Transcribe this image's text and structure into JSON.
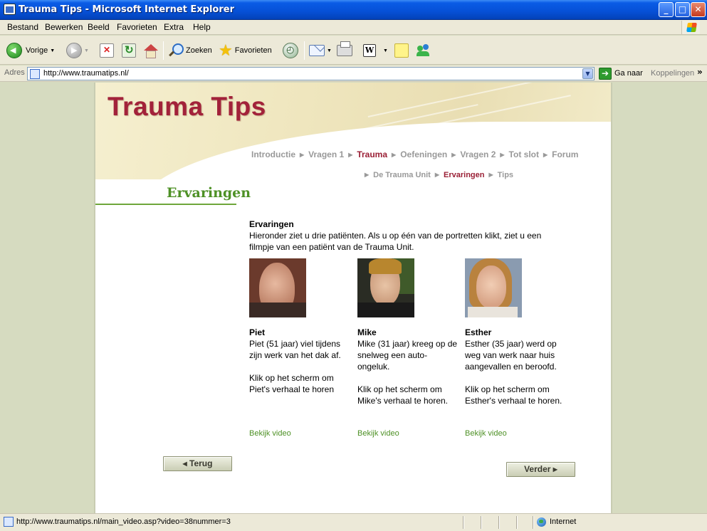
{
  "window": {
    "title": "Trauma Tips - Microsoft Internet Explorer",
    "minimize": "_",
    "maximize": "□",
    "close": "✕"
  },
  "menu": {
    "items": [
      "Bestand",
      "Bewerken",
      "Beeld",
      "Favorieten",
      "Extra",
      "Help"
    ]
  },
  "toolbar": {
    "back_label": "Vorige",
    "search_label": "Zoeken",
    "favorites_label": "Favorieten",
    "icons": [
      "back-icon",
      "forward-icon",
      "stop-icon",
      "refresh-icon",
      "home-icon",
      "search-icon",
      "favorites-star-icon",
      "media-icon",
      "mail-icon",
      "print-icon",
      "word-icon",
      "note-icon",
      "messenger-icon"
    ],
    "word_glyph": "W"
  },
  "address": {
    "label": "Adres",
    "url": "http://www.traumatips.nl/",
    "go_label": "Ga naar",
    "links_label": "Koppelingen",
    "overflow": "»"
  },
  "site": {
    "logo": "Trauma Tips",
    "nav_primary": [
      {
        "label": "Introductie",
        "active": false
      },
      {
        "label": "Vragen 1",
        "active": false
      },
      {
        "label": "Trauma",
        "active": true
      },
      {
        "label": "Oefeningen",
        "active": false
      },
      {
        "label": "Vragen 2",
        "active": false
      },
      {
        "label": "Tot slot",
        "active": false
      },
      {
        "label": "Forum",
        "active": false
      }
    ],
    "nav_secondary": [
      {
        "label": "De Trauma Unit",
        "active": false
      },
      {
        "label": "Ervaringen",
        "active": true
      },
      {
        "label": "Tips",
        "active": false
      }
    ],
    "colors": {
      "brand": "#a2223a",
      "accent_green": "#4e9126",
      "nav_gray": "#999999"
    }
  },
  "content": {
    "section_title": "Ervaringen",
    "intro_title": "Ervaringen",
    "intro_text": "Hieronder ziet u drie patiënten. Als u op één van de portretten klikt, ziet u een filmpje van een patiënt van de Trauma Unit.",
    "patients": [
      {
        "name": "Piet",
        "description": "Piet (51 jaar) viel tijdens zijn werk van het dak af.",
        "cta": "Klik op het scherm om Piet's verhaal te horen",
        "link": "Bekijk video"
      },
      {
        "name": "Mike",
        "description": "Mike (31 jaar) kreeg op de snelweg een auto-ongeluk.",
        "cta": "Klik op het scherm om Mike's verhaal te horen.",
        "link": "Bekijk video"
      },
      {
        "name": "Esther",
        "description": "Esther (35 jaar) werd op weg van werk naar huis aangevallen en beroofd.",
        "cta": "Klik op het scherm om Esther's verhaal te horen.",
        "link": "Bekijk video"
      }
    ],
    "back_button": "Terug",
    "next_button": "Verder"
  },
  "status": {
    "text": "http://www.traumatips.nl/main_video.asp?video=38nummer=3",
    "zone": "Internet"
  }
}
